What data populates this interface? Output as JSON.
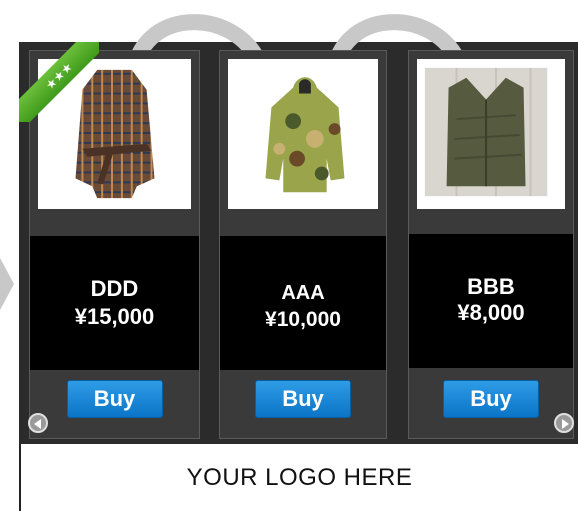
{
  "products": [
    {
      "name": "DDD",
      "price": "¥15,000",
      "buy_label": "Buy",
      "badge": "★★★"
    },
    {
      "name": "AAA",
      "price": "¥10,000",
      "buy_label": "Buy"
    },
    {
      "name": "BBB",
      "price": "¥8,000",
      "buy_label": "Buy"
    }
  ],
  "footer": {
    "logo_text": "YOUR LOGO HERE"
  },
  "colors": {
    "button": "#1583d6",
    "ribbon": "#5aad2c",
    "panel": "#000000",
    "arrow": "#c8c8c8"
  }
}
